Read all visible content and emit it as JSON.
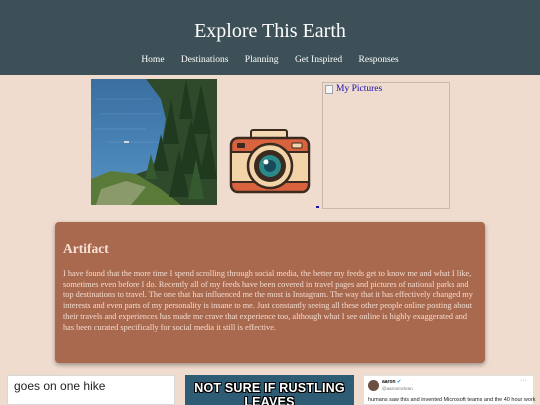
{
  "site": {
    "title": "Explore This Earth"
  },
  "nav": [
    "Home",
    "Destinations",
    "Planning",
    "Get Inspired",
    "Responses"
  ],
  "images": {
    "lake_photo": "lake-photo",
    "camera": "camera-illustration",
    "broken_alt": "My Pictures"
  },
  "article": {
    "title": "Artifact",
    "body": "I have found that the more time I spend scrolling through social media, the better my feeds get to know me and what I like, sometimes even before I do. Recently all of my feeds have been covered in travel pages and pictures of national parks and top destinations to travel. The one that has influenced me the most is Instagram. The way that it has effectively changed my interests and even parts of my personality is insane to me. Just constantly seeing all these other people online posting about their travels and experiences has made me crave that experience too, although what I see online is highly exaggerated and has been curated specifically for social media it still is effective."
  },
  "bottom": {
    "post_text": "goes on one hike",
    "meme_text": "NOT SURE IF RUSTLING LEAVES",
    "tweet": {
      "name": "aaron",
      "handle": "@aaronmclean",
      "dots": "···",
      "text": "humans saw this and invented Microsoft teams and the 40 hour work"
    }
  },
  "colors": {
    "header": "#3d5058",
    "page_bg": "#efdccf",
    "card_bg": "#a9694f",
    "card_text": "#f3dccf",
    "link": "#1a0dab"
  }
}
